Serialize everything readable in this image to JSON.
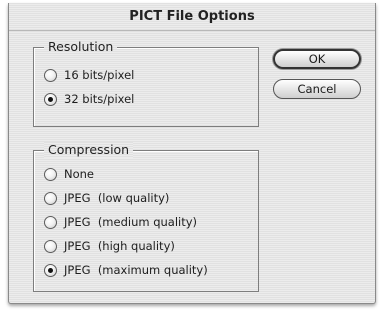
{
  "dialog": {
    "title": "PICT File Options"
  },
  "resolution": {
    "legend": "Resolution",
    "options": [
      {
        "label": "16 bits/pixel",
        "selected": false
      },
      {
        "label": "32 bits/pixel",
        "selected": true
      }
    ]
  },
  "compression": {
    "legend": "Compression",
    "options": [
      {
        "label": "None",
        "selected": false
      },
      {
        "label": "JPEG  (low quality)",
        "selected": false
      },
      {
        "label": "JPEG  (medium quality)",
        "selected": false
      },
      {
        "label": "JPEG  (high quality)",
        "selected": false
      },
      {
        "label": "JPEG  (maximum quality)",
        "selected": true
      }
    ]
  },
  "buttons": {
    "ok_label": "OK",
    "cancel_label": "Cancel"
  }
}
